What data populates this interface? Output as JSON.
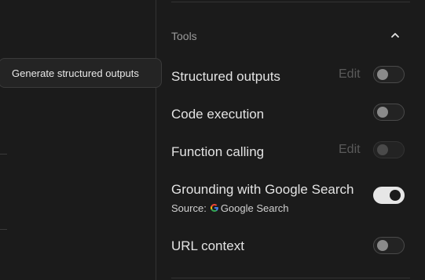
{
  "tooltip": {
    "text": "Generate structured outputs"
  },
  "tools": {
    "title": "Tools",
    "items": [
      {
        "label": "Structured outputs",
        "edit": "Edit",
        "enabled": false
      },
      {
        "label": "Code execution",
        "enabled": false
      },
      {
        "label": "Function calling",
        "edit": "Edit",
        "enabled": false,
        "disabled": true
      },
      {
        "label": "Grounding with Google Search",
        "enabled": true,
        "source_prefix": "Source:",
        "source_name": "Google Search"
      },
      {
        "label": "URL context",
        "enabled": false
      }
    ]
  },
  "icons": {
    "collapse": "chevron-up-icon",
    "google": "google-g-icon"
  }
}
